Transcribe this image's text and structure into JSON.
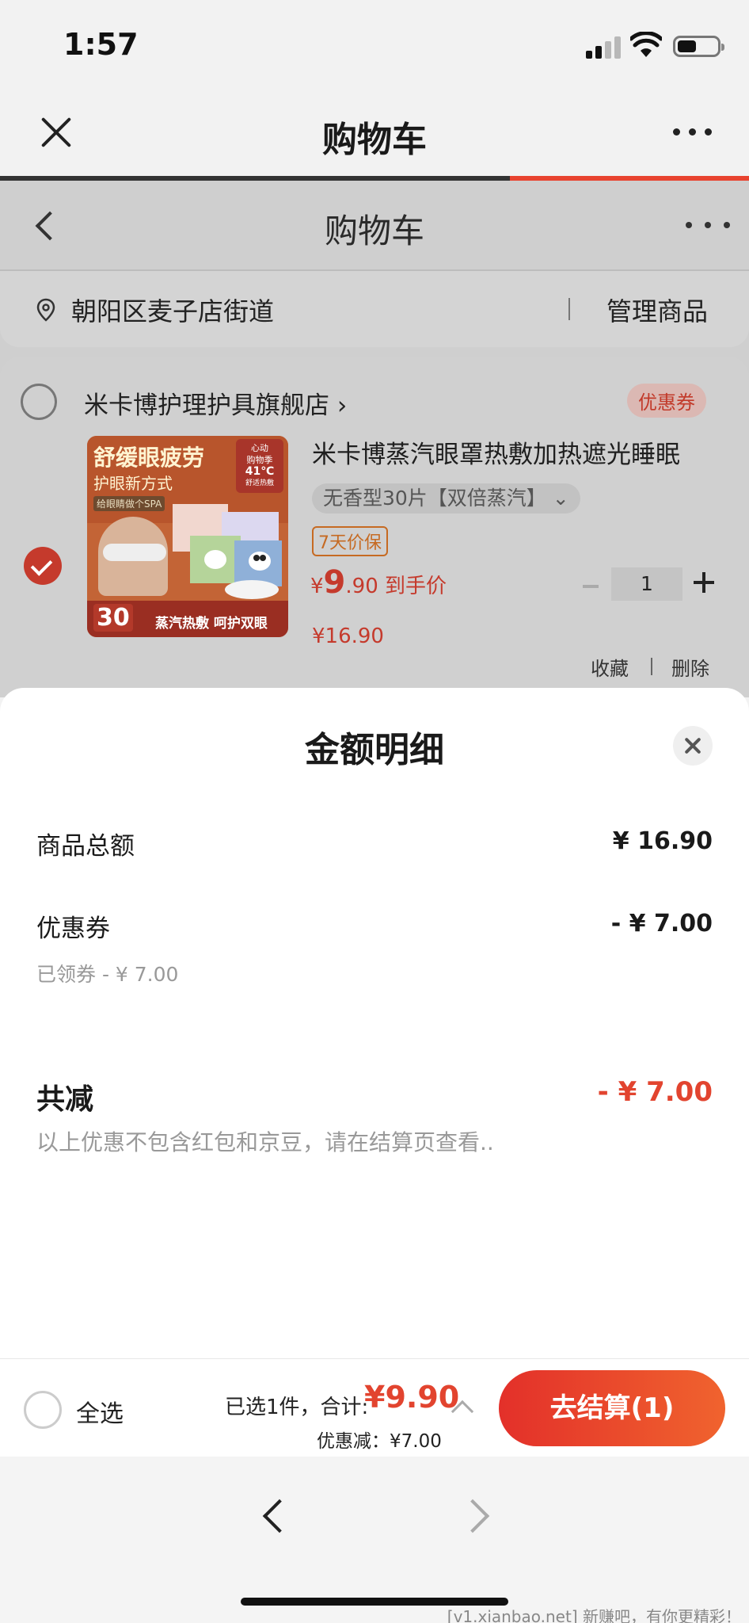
{
  "status": {
    "time": "1:57"
  },
  "nav": {
    "title": "购物车"
  },
  "page": {
    "title": "购物车",
    "location": "朝阳区麦子店街道",
    "manage": "管理商品"
  },
  "store": {
    "name": "米卡博护理护具旗舰店 ›",
    "coupon_tag": "优惠券"
  },
  "product": {
    "image_texts": {
      "headline": "舒缓眼疲劳",
      "sub": "护眼新方式",
      "tag": "给眼睛做个SPA",
      "badge_line1": "心动",
      "badge_line2": "购物季",
      "badge_temp": "41℃",
      "badge_note": "舒适热敷",
      "count": "30",
      "slogan": "蒸汽热敷 呵护双眼"
    },
    "title": "米卡博蒸汽眼罩热敷加热遮光睡眠",
    "variant": "无香型30片【双倍蒸汽】 ⌄",
    "guarantee": "7天价保",
    "price_currency": "¥",
    "price_int": "9",
    "price_dec": ".90",
    "price_suffix": " 到手价",
    "original_price": "¥16.90",
    "quantity": "1",
    "favorite": "收藏",
    "delete": "删除"
  },
  "sheet": {
    "title": "金额明细",
    "rows": [
      {
        "label": "商品总额",
        "value": "¥ 16.90"
      },
      {
        "label": "优惠券",
        "value": "- ¥ 7.00",
        "sub": "已领券 - ¥ 7.00"
      }
    ],
    "total_label": "共减",
    "total_value": "- ¥ 7.00",
    "note": "以上优惠不包含红包和京豆，请在结算页查看.."
  },
  "checkout": {
    "select_all": "全选",
    "summary": "已选1件，合计:",
    "total": "¥9.90",
    "discount": "优惠减：¥7.00",
    "button": "去结算(1)"
  },
  "watermark": "[v1.xianbao.net] 新赚吧，有你更精彩！",
  "colors": {
    "accent": "#e2442f",
    "checkout_gradient_start": "#e3302a",
    "checkout_gradient_end": "#f0632e"
  }
}
